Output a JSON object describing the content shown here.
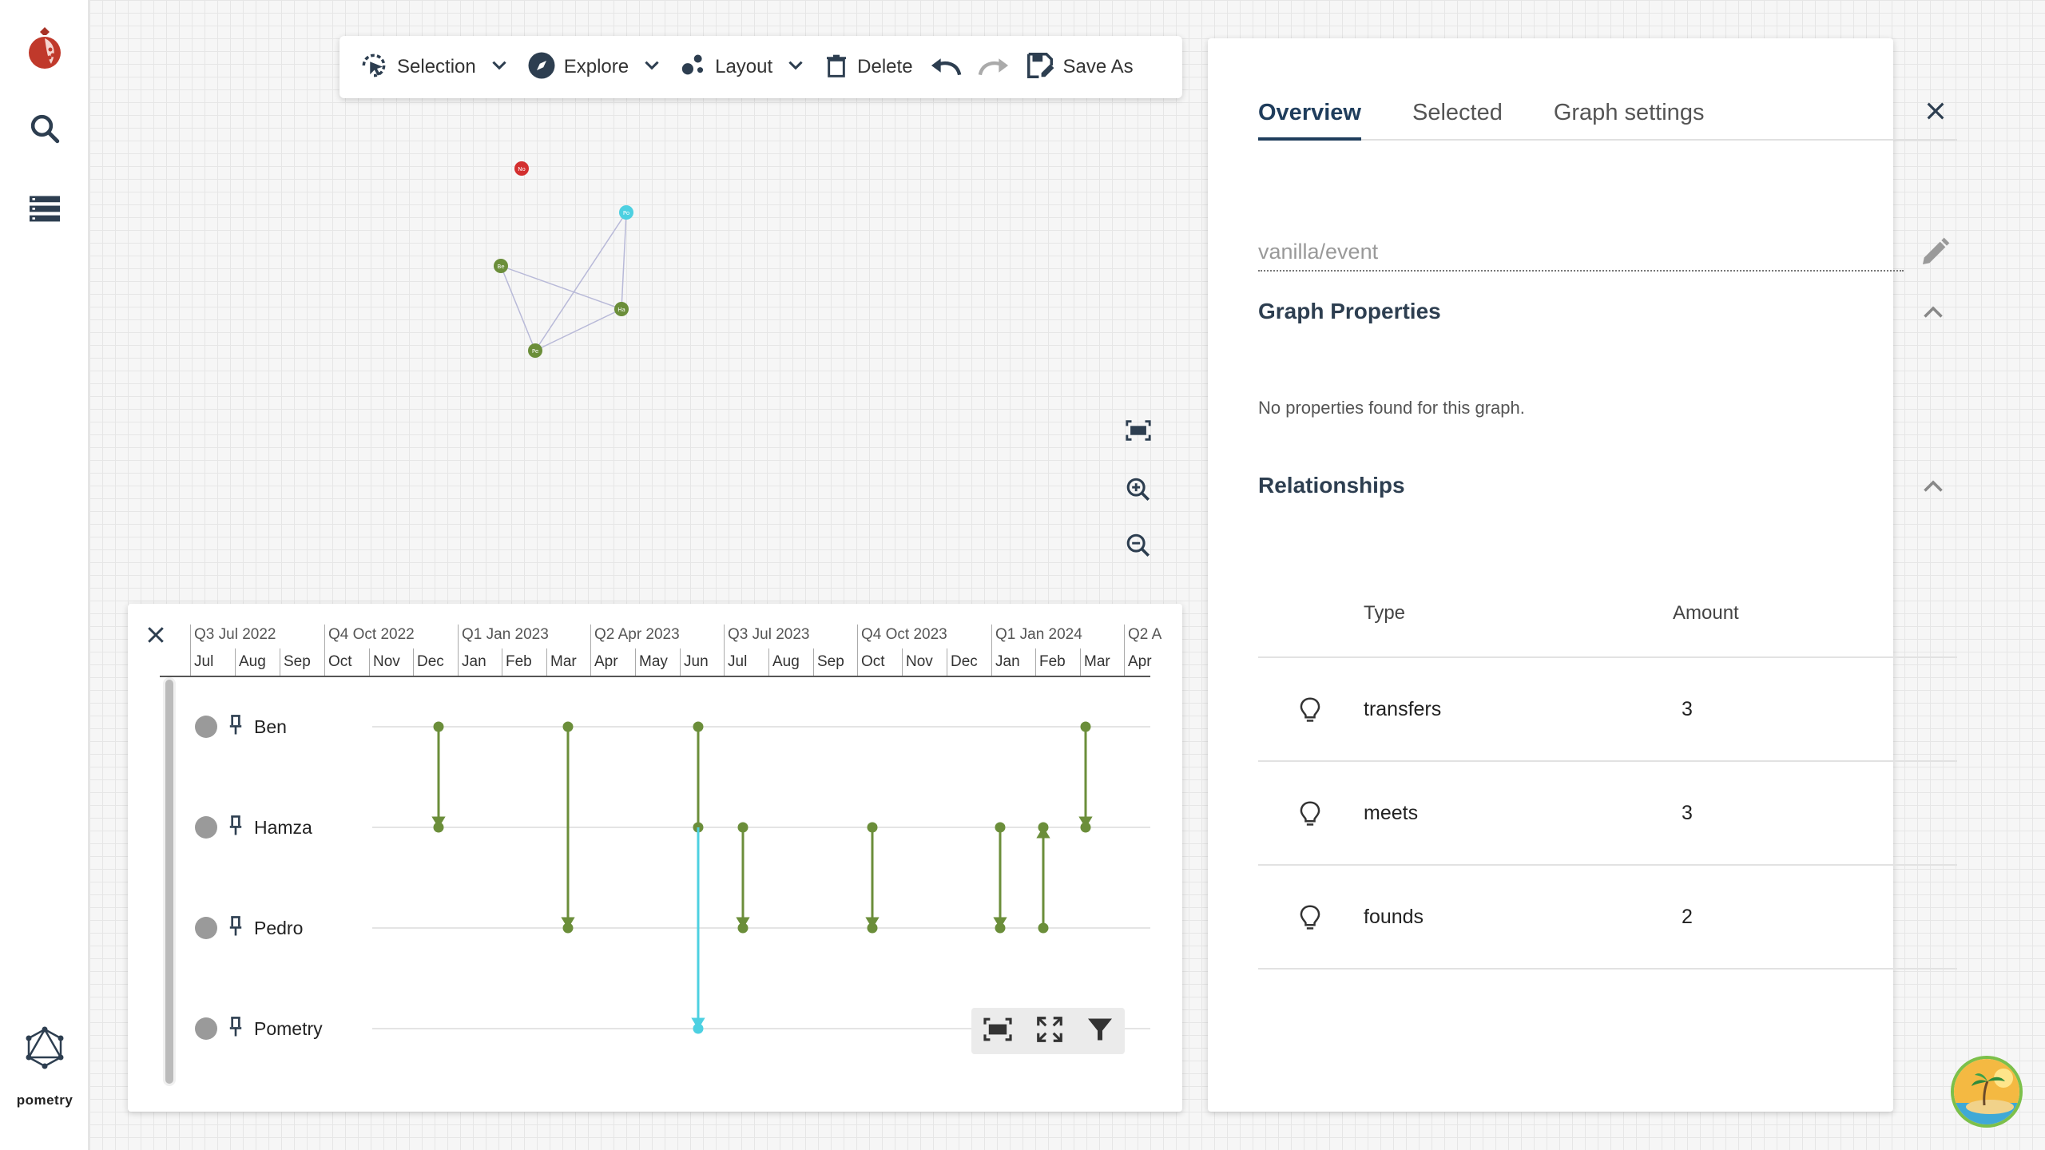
{
  "brand": {
    "name": "pometry",
    "accent": "#c0392b"
  },
  "sidebar": {
    "items": [
      {
        "icon": "search-icon"
      },
      {
        "icon": "list-icon"
      }
    ]
  },
  "toolbar": {
    "selection_label": "Selection",
    "explore_label": "Explore",
    "layout_label": "Layout",
    "delete_label": "Delete",
    "save_as_label": "Save As"
  },
  "graph": {
    "nodes": [
      {
        "id": "red",
        "label": "No",
        "color": "#d32f2f"
      },
      {
        "id": "cyan",
        "label": "Po",
        "color": "#4dd0e1"
      },
      {
        "id": "ben",
        "label": "Be",
        "color": "#6b8e3a"
      },
      {
        "id": "hamza",
        "label": "Ha",
        "color": "#6b8e3a"
      },
      {
        "id": "pedro",
        "label": "Pe",
        "color": "#6b8e3a"
      }
    ]
  },
  "timeline": {
    "quarters": [
      "Q3 Jul 2022",
      "Q4 Oct 2022",
      "Q1 Jan 2023",
      "Q2 Apr 2023",
      "Q3 Jul 2023",
      "Q4 Oct 2023",
      "Q1 Jan 2024",
      "Q2 A"
    ],
    "months": [
      "Jul",
      "Aug",
      "Sep",
      "Oct",
      "Nov",
      "Dec",
      "Jan",
      "Feb",
      "Mar",
      "Apr",
      "May",
      "Jun",
      "Jul",
      "Aug",
      "Sep",
      "Oct",
      "Nov",
      "Dec",
      "Jan",
      "Feb",
      "Mar",
      "Apr"
    ],
    "rows": [
      {
        "name": "Ben"
      },
      {
        "name": "Hamza"
      },
      {
        "name": "Pedro"
      },
      {
        "name": "Pometry"
      }
    ],
    "event_color": "#6b8e3a",
    "highlight_color": "#4dd0e1"
  },
  "panel": {
    "tabs": [
      "Overview",
      "Selected",
      "Graph settings"
    ],
    "active_tab": "Overview",
    "graph_name": "vanilla/event",
    "graph_properties_title": "Graph Properties",
    "no_properties_text": "No properties found for this graph.",
    "relationships_title": "Relationships",
    "relationships_header": {
      "type": "Type",
      "amount": "Amount"
    },
    "relationships": [
      {
        "type": "transfers",
        "amount": "3"
      },
      {
        "type": "meets",
        "amount": "3"
      },
      {
        "type": "founds",
        "amount": "2"
      }
    ]
  }
}
